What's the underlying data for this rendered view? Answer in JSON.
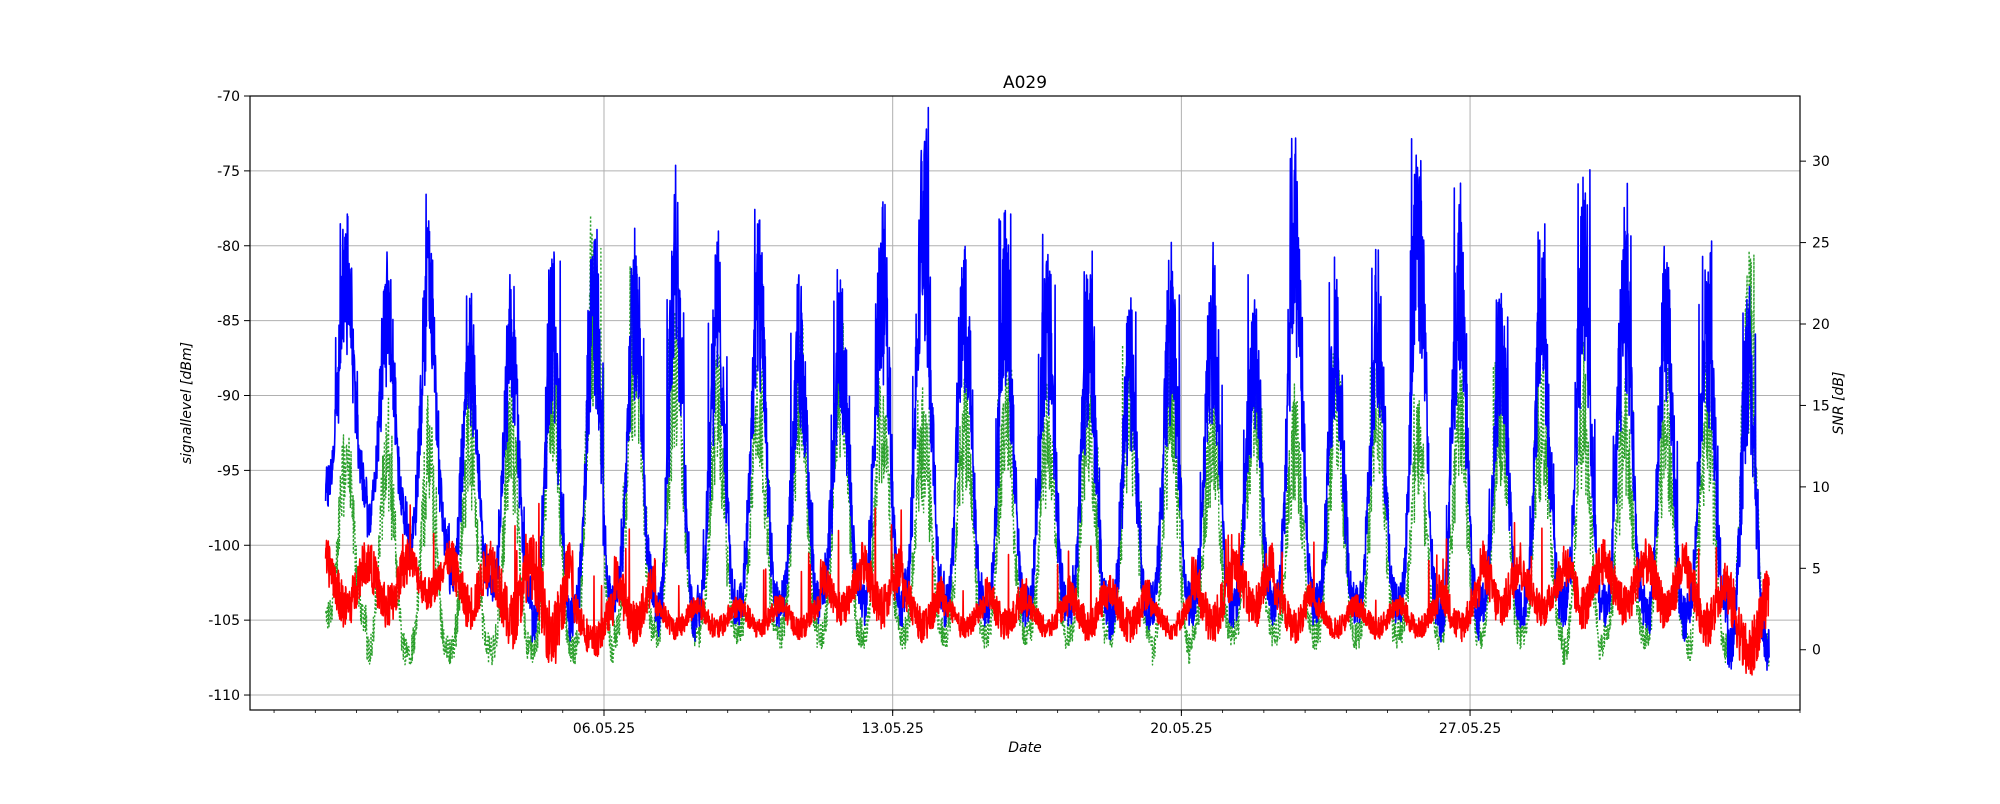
{
  "chart_data": {
    "type": "line",
    "title": "A029",
    "xlabel": "Date",
    "ylabel": "signallevel [dBm]",
    "ylabel_right": "SNR [dB]",
    "x_start": "2025-04-29",
    "x_end": "2025-06-03",
    "xlim": [
      "2025-04-27T10:00",
      "2025-06-04T00:00"
    ],
    "ylim": [
      -111,
      -70
    ],
    "ylim_right": [
      -3.7,
      34.0
    ],
    "grid": true,
    "x_ticks": [
      "06.05.25",
      "13.05.25",
      "20.05.25",
      "27.05.25"
    ],
    "y_ticks": [
      -70,
      -75,
      -80,
      -85,
      -90,
      -95,
      -100,
      -105,
      -110
    ],
    "y_ticks_right": [
      0,
      5,
      10,
      15,
      20,
      25,
      30
    ],
    "series": [
      {
        "axis": "left",
        "color": "#0000ff",
        "style": "solid",
        "daily_peak": [
          -78,
          -81,
          -78,
          -83,
          -81,
          -80,
          -79,
          -79,
          -75,
          -79,
          -78,
          -82,
          -82,
          -76,
          -72,
          -78,
          -79,
          -80,
          -81,
          -83,
          -80,
          -81,
          -83,
          -73,
          -82,
          -81,
          -72,
          -76,
          -82,
          -80,
          -76,
          -77,
          -80,
          -81,
          -83
        ],
        "daily_trough": [
          -96,
          -98,
          -100,
          -102,
          -103,
          -105,
          -104,
          -103,
          -105,
          -104,
          -104,
          -104,
          -103,
          -104,
          -103,
          -104,
          -104,
          -104,
          -104,
          -105,
          -104,
          -104,
          -104,
          -104,
          -104,
          -104,
          -104,
          -105,
          -104,
          -104,
          -104,
          -104,
          -105,
          -104,
          -107
        ]
      },
      {
        "axis": "right",
        "color": "#ff0000",
        "style": "solid",
        "daily_peak": [
          6,
          6,
          6,
          6,
          6,
          6,
          3,
          5,
          3,
          3,
          3,
          3,
          5,
          6,
          4,
          3,
          4,
          3,
          4,
          4,
          3,
          5,
          6,
          4,
          3,
          3,
          3,
          4,
          6,
          5,
          6,
          6,
          6,
          5,
          4
        ],
        "daily_trough": [
          2,
          2,
          3,
          2,
          1,
          0,
          0,
          1,
          1,
          1,
          1,
          1,
          2,
          2,
          1,
          1,
          1,
          1,
          1,
          1,
          1,
          1,
          2,
          1,
          1,
          1,
          1,
          1,
          2,
          2,
          2,
          2,
          2,
          1,
          -1
        ]
      },
      {
        "axis": "right",
        "color": "#2ca02c",
        "style": "dotted",
        "daily_peak": [
          14,
          15,
          15,
          16,
          17,
          20,
          27,
          24,
          21,
          18,
          19,
          20,
          21,
          17,
          16,
          17,
          18,
          16,
          17,
          19,
          18,
          17,
          19,
          16,
          19,
          18,
          16,
          18,
          18,
          17,
          18,
          17,
          17,
          19,
          24
        ],
        "daily_trough": [
          2,
          0,
          0,
          0,
          0,
          0,
          0,
          1,
          1,
          1,
          1,
          1,
          1,
          1,
          1,
          1,
          1,
          1,
          1,
          1,
          0,
          1,
          1,
          1,
          1,
          1,
          1,
          1,
          1,
          1,
          0,
          1,
          1,
          0,
          0
        ]
      }
    ]
  }
}
